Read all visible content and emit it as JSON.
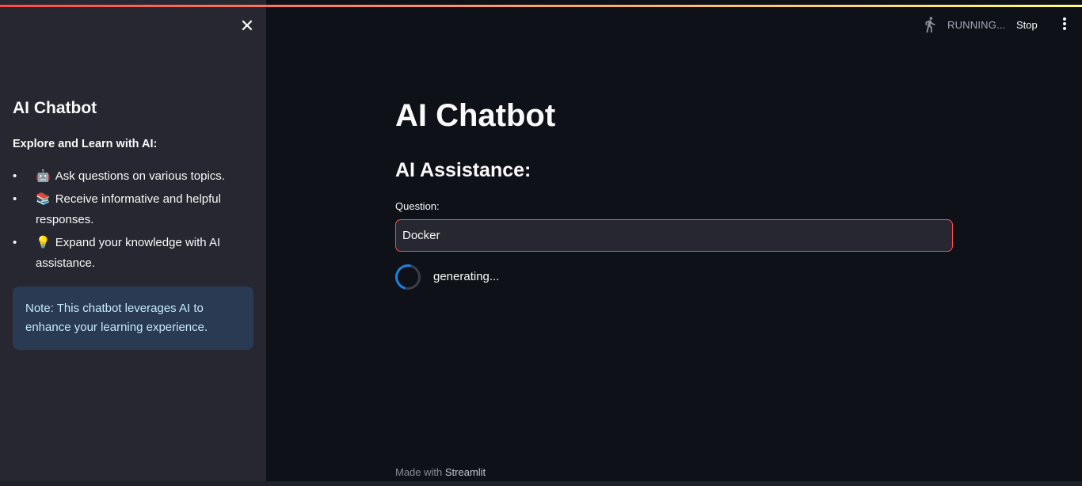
{
  "sidebar": {
    "close_glyph": "✕",
    "title": "AI Chatbot",
    "subtitle": "Explore and Learn with AI:",
    "items": [
      {
        "emoji": "🤖",
        "text": "Ask questions on various topics."
      },
      {
        "emoji": "📚",
        "text": "Receive informative and helpful responses."
      },
      {
        "emoji": "💡",
        "text": "Expand your knowledge with AI assistance."
      }
    ],
    "note": "Note: This chatbot leverages AI to enhance your learning experience."
  },
  "header": {
    "status": "RUNNING...",
    "stop_label": "Stop",
    "icons": [
      "running-man-icon",
      "kebab-menu-icon"
    ]
  },
  "main": {
    "title": "AI Chatbot",
    "subtitle": "AI Assistance:",
    "question_label": "Question:",
    "question_value": "Docker",
    "status_text": "generating..."
  },
  "footer": {
    "prefix": "Made with ",
    "brand": "Streamlit"
  },
  "colors": {
    "background": "#0e1117",
    "sidebar": "#262730",
    "accent": "#ff4b4b",
    "info_bg": "#293a52",
    "info_text": "#c7ebff",
    "spinner": "#1c83e1"
  }
}
